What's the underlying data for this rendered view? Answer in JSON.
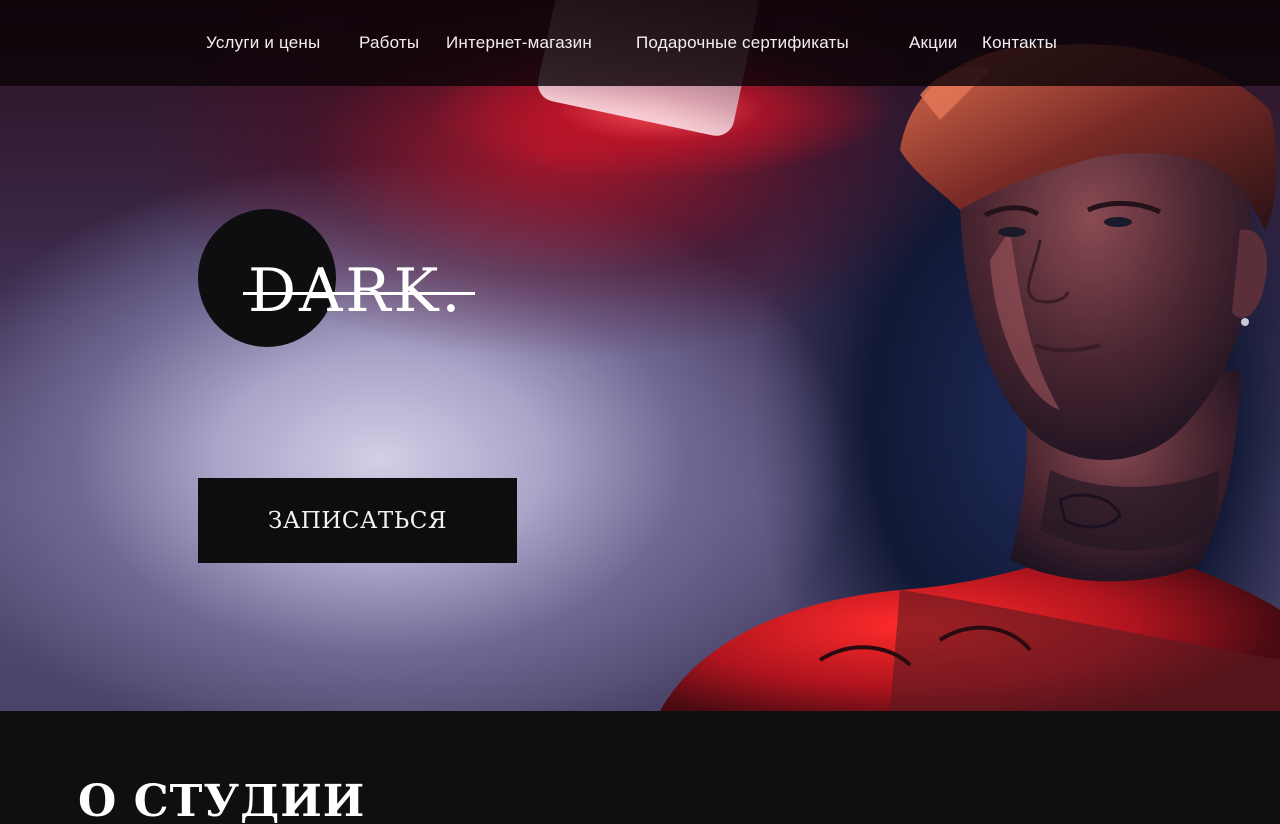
{
  "nav": {
    "items": [
      {
        "label": "Услуги и цены"
      },
      {
        "label": "Работы"
      },
      {
        "label": "Интернет-магазин"
      },
      {
        "label": "Подарочные сертификаты"
      },
      {
        "label": "Акции"
      },
      {
        "label": "Контакты"
      }
    ]
  },
  "hero": {
    "logo_text": "DARK.",
    "cta_label": "ЗАПИСАТЬСЯ"
  },
  "about": {
    "title": "О СТУДИИ"
  },
  "colors": {
    "background": "#0f0e10",
    "nav_bar": "#0c0408",
    "button": "#0d0c0e",
    "text": "#ffffff",
    "accent_red": "#c8142a",
    "accent_blue": "#1f2a5a"
  }
}
